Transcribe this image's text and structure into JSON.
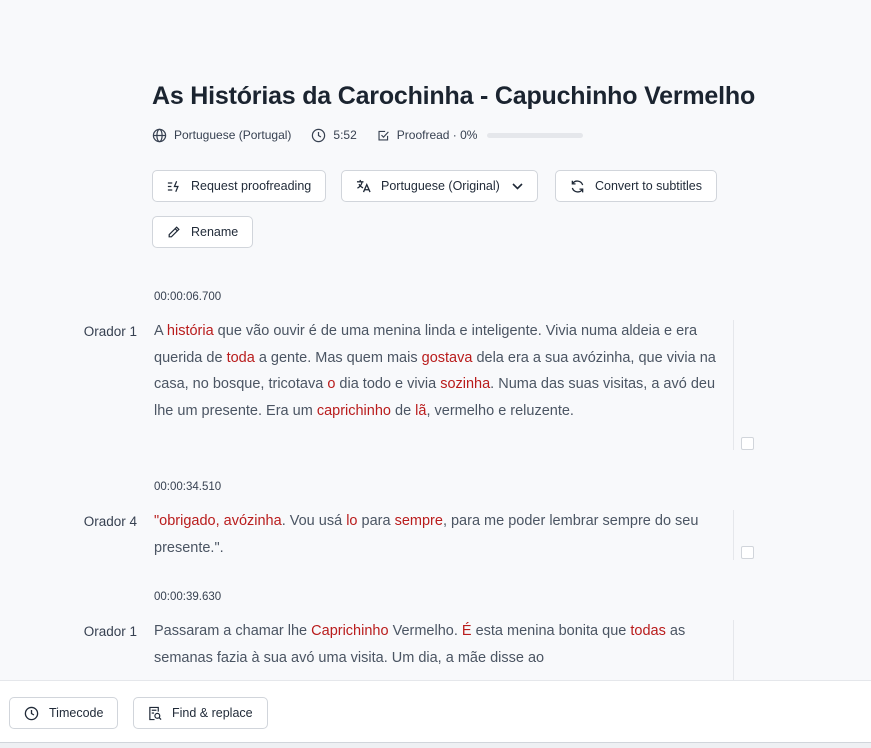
{
  "document": {
    "title": "As Histórias da Carochinha - Capuchinho Vermelho",
    "language": "Portuguese (Portugal)",
    "duration": "5:52",
    "proofread_status": "Proofread · 0%",
    "proofread_progress": 0
  },
  "toolbar": {
    "request_proofreading_label": "Request proofreading",
    "language_select_label": "Portuguese (Original)",
    "convert_label": "Convert to subtitles",
    "rename_label": "Rename"
  },
  "segments": [
    {
      "timestamp": "00:00:06.700",
      "speaker": "Orador 1",
      "text": [
        {
          "t": "A "
        },
        {
          "t": "história",
          "hl": true
        },
        {
          "t": " que vão ouvir é de uma menina linda e inteligente. Vivia numa aldeia e era querida de "
        },
        {
          "t": "toda",
          "hl": true
        },
        {
          "t": " a gente. Mas quem mais "
        },
        {
          "t": "gostava",
          "hl": true
        },
        {
          "t": " dela era a sua avózinha, que vivia na casa, no bosque, tricotava "
        },
        {
          "t": "o",
          "hl": true
        },
        {
          "t": " dia todo e vivia "
        },
        {
          "t": "sozinha",
          "hl": true
        },
        {
          "t": ". Numa das suas visitas, a avó deu lhe um presente. Era um "
        },
        {
          "t": "caprichinho",
          "hl": true
        },
        {
          "t": " de "
        },
        {
          "t": "lã",
          "hl": true
        },
        {
          "t": ", vermelho e reluzente."
        }
      ]
    },
    {
      "timestamp": "00:00:34.510",
      "speaker": "Orador 4",
      "text": [
        {
          "t": "\"obrigado, avózinha",
          "hl": true
        },
        {
          "t": ". Vou usá "
        },
        {
          "t": "lo",
          "hl": true
        },
        {
          "t": " para "
        },
        {
          "t": "sempre",
          "hl": true
        },
        {
          "t": ", para me poder lembrar sempre do seu presente.\"."
        }
      ]
    },
    {
      "timestamp": "00:00:39.630",
      "speaker": "Orador 1",
      "text": [
        {
          "t": "Passaram a chamar lhe "
        },
        {
          "t": "Caprichinho",
          "hl": true
        },
        {
          "t": " Vermelho. "
        },
        {
          "t": "É",
          "hl": true
        },
        {
          "t": " esta menina bonita que "
        },
        {
          "t": "todas",
          "hl": true
        },
        {
          "t": " as semanas fazia à sua avó uma visita. Um dia, a mãe disse ao"
        }
      ]
    }
  ],
  "bottom_toolbar": {
    "timecode_label": "Timecode",
    "find_replace_label": "Find & replace"
  },
  "colors": {
    "highlight": "#b91c1c",
    "text": "#4b5563",
    "title": "#1b2430"
  },
  "icons": [
    "globe-icon",
    "clock-icon",
    "check-square-icon",
    "request-proofreading-icon",
    "translate-icon",
    "chevron-down-icon",
    "refresh-icon",
    "pencil-icon",
    "find-replace-icon"
  ]
}
